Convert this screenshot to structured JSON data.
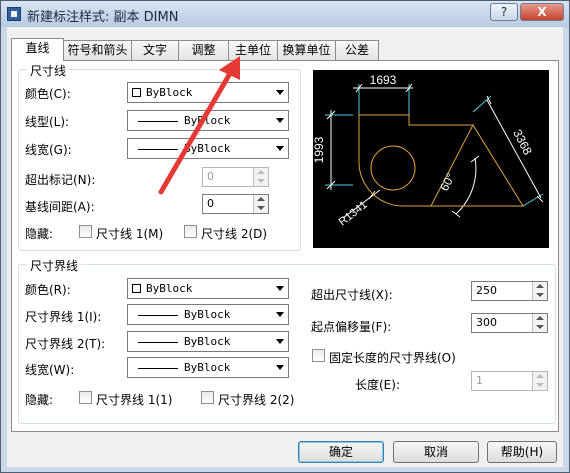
{
  "window": {
    "title": "新建标注样式: 副本 DIMN",
    "help_glyph": "?",
    "close_glyph": "X"
  },
  "tabs": [
    "直线",
    "符号和箭头",
    "文字",
    "调整",
    "主单位",
    "换算单位",
    "公差"
  ],
  "dim_lines": {
    "legend": "尺寸线",
    "color_label": "颜色(C):",
    "color_value": "ByBlock",
    "linetype_label": "线型(L):",
    "linetype_value": "ByBlock",
    "lineweight_label": "线宽(G):",
    "lineweight_value": "ByBlock",
    "extend_label": "超出标记(N):",
    "extend_value": "0",
    "baseline_label": "基线间距(A):",
    "baseline_value": "0",
    "suppress_label": "隐藏:",
    "suppress1_label": "尺寸线 1(M)",
    "suppress2_label": "尺寸线 2(D)"
  },
  "ext_lines": {
    "legend": "尺寸界线",
    "color_label": "颜色(R):",
    "color_value": "ByBlock",
    "lt1_label": "尺寸界线 1(I):",
    "lt1_value": "ByBlock",
    "lt2_label": "尺寸界线 2(T):",
    "lt2_value": "ByBlock",
    "lineweight_label": "线宽(W):",
    "lineweight_value": "ByBlock",
    "suppress_label": "隐藏:",
    "suppress1_label": "尺寸界线 1(1)",
    "suppress2_label": "尺寸界线 2(2)",
    "beyond_label": "超出尺寸线(X):",
    "beyond_value": "250",
    "offset_label": "起点偏移量(F):",
    "offset_value": "300",
    "fixed_label": "固定长度的尺寸界线(O)",
    "length_label": "长度(E):",
    "length_value": "1"
  },
  "preview": {
    "dim_top": "1693",
    "dim_left": "1993",
    "dim_right": "3368",
    "dim_radius": "R1341",
    "dim_angle": "60°"
  },
  "buttons": {
    "ok": "确定",
    "cancel": "取消",
    "help": "帮助(H)"
  },
  "colors": {
    "preview_line": "#e0a33c",
    "preview_dim": "#ffffff",
    "preview_ext": "#4fd1e6",
    "annotation_arrow": "#e53935"
  }
}
